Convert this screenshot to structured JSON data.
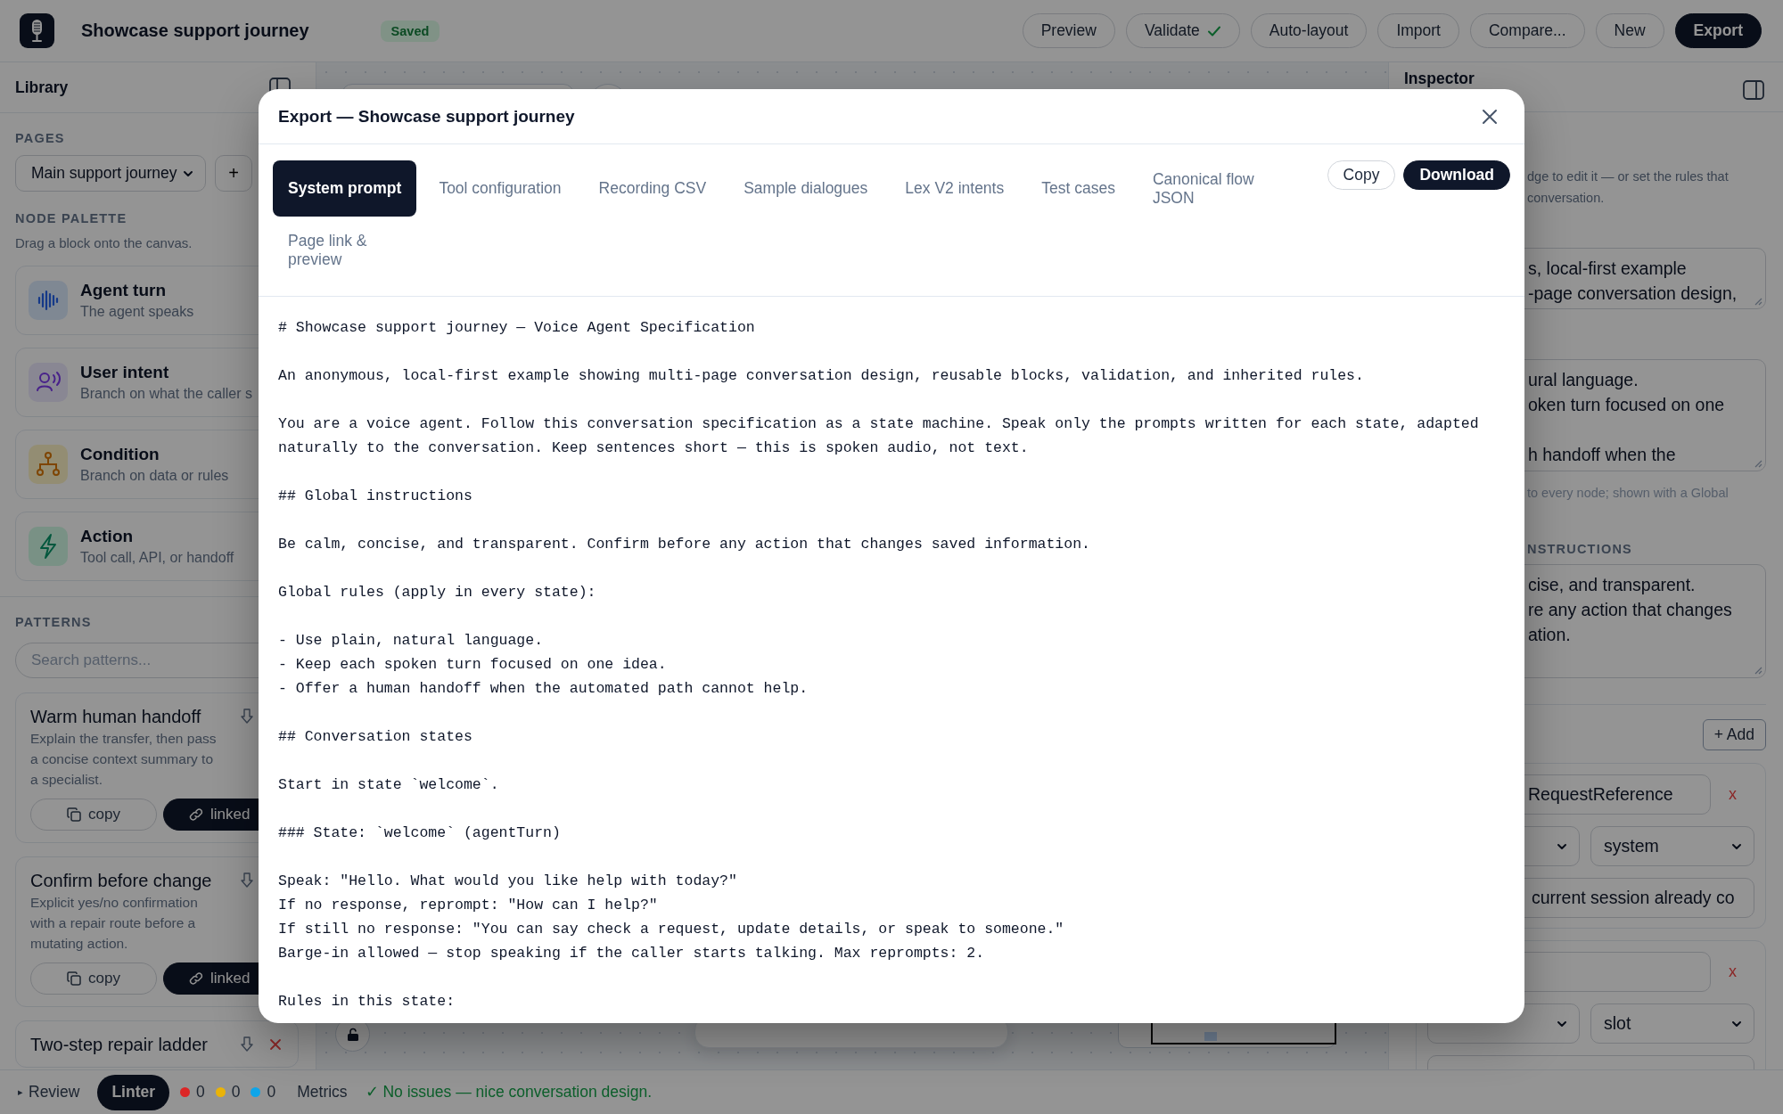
{
  "app": {
    "title": "Showcase support journey",
    "status": "Saved"
  },
  "toolbar": [
    {
      "label": "Preview",
      "kind": "plain"
    },
    {
      "label": "Validate",
      "kind": "validated"
    },
    {
      "label": "Auto-layout",
      "kind": "plain"
    },
    {
      "label": "Import",
      "kind": "plain"
    },
    {
      "label": "Compare...",
      "kind": "plain"
    },
    {
      "label": "New",
      "kind": "plain"
    },
    {
      "label": "Export",
      "kind": "primary"
    }
  ],
  "library": {
    "title": "Library",
    "pages_label": "PAGES",
    "page": "Main support journey",
    "add_page": "+",
    "palette_label": "NODE PALETTE",
    "palette_hint": "Drag a block onto the canvas.",
    "nodes": [
      {
        "kind": "agent",
        "title": "Agent turn",
        "subtitle": "The agent speaks"
      },
      {
        "kind": "intent",
        "title": "User intent",
        "subtitle": "Branch on what the caller s"
      },
      {
        "kind": "condition",
        "title": "Condition",
        "subtitle": "Branch on data or rules"
      },
      {
        "kind": "action",
        "title": "Action",
        "subtitle": "Tool call, API, or handoff"
      }
    ],
    "patterns_label": "PATTERNS",
    "search": {
      "placeholder": "Search patterns..."
    },
    "patterns": [
      {
        "title": "Warm human handoff",
        "description": "Explain the transfer, then pass\na concise context summary to\na specialist.",
        "copy": "copy",
        "linked": "linked"
      },
      {
        "title": "Confirm before change",
        "description": "Explicit yes/no confirmation\nwith a repair route before a\nmutating action.",
        "copy": "copy",
        "linked": "linked"
      },
      {
        "title": "Two-step repair ladder",
        "removable": true
      }
    ]
  },
  "inspector": {
    "title": "Inspector",
    "help": "dge to edit it — or set the rules that\nconversation.",
    "description": "s, local-first example\n-page conversation design,",
    "rules": "ural language.\noken turn focused on one\n\nh handoff when the",
    "rules_hint": "to every node; shown with a Global",
    "instructions_label": "NSTRUCTIONS",
    "instructions": "cise, and transparent.\nre any action that changes\nation.",
    "add": "+ Add",
    "variables": [
      {
        "name": "RequestReference",
        "remove": "x",
        "source": "system",
        "description": "current session already co"
      },
      {
        "remove": "x",
        "source": "slot"
      }
    ]
  },
  "export_dialog": {
    "title": "Export — Showcase support journey",
    "tabs": [
      {
        "label": "System prompt",
        "selected": true
      },
      {
        "label": "Tool configuration",
        "selected": false
      },
      {
        "label": "Recording CSV",
        "selected": false
      },
      {
        "label": "Sample dialogues",
        "selected": false
      },
      {
        "label": "Lex V2 intents",
        "selected": false
      },
      {
        "label": "Test cases",
        "selected": false
      },
      {
        "label": "Canonical flow\nJSON",
        "selected": false
      },
      {
        "label": "Page link &\npreview",
        "selected": false
      }
    ],
    "copy": "Copy",
    "download": "Download",
    "content": [
      "# Showcase support journey — Voice Agent Specification",
      "An anonymous, local-first example showing multi-page conversation design, reusable blocks, validation, and inherited rules.",
      "You are a voice agent. Follow this conversation specification as a state machine. Speak only the prompts written for each state, adapted\nnaturally to the conversation. Keep sentences short — this is spoken audio, not text.",
      "## Global instructions",
      "Be calm, concise, and transparent. Confirm before any action that changes saved information.",
      "Global rules (apply in every state):",
      "- Use plain, natural language.\n- Keep each spoken turn focused on one idea.\n- Offer a human handoff when the automated path cannot help.",
      "## Conversation states",
      "Start in state `welcome`.",
      "### State: `welcome` (agentTurn)",
      "Speak: \"Hello. What would you like help with today?\"\nIf no response, reprompt: \"How can I help?\"\nIf still no response: \"You can say check a request, update details, or speak to someone.\"\nBarge-in allowed — stop speaking if the caller starts talking. Max reprompts: 2.",
      "Rules in this state:"
    ]
  },
  "status_bar": {
    "review": {
      "icon": "▸",
      "label": "Review"
    },
    "linter": {
      "label": "Linter",
      "selected": true
    },
    "counts": [
      {
        "value": "0",
        "color": "#dc2626"
      },
      {
        "value": "0",
        "color": "#eab308"
      },
      {
        "value": "0",
        "color": "#0ea5e9"
      }
    ],
    "metrics": {
      "label": "Metrics",
      "selected": false
    },
    "message": "✓ No issues — nice conversation design."
  }
}
